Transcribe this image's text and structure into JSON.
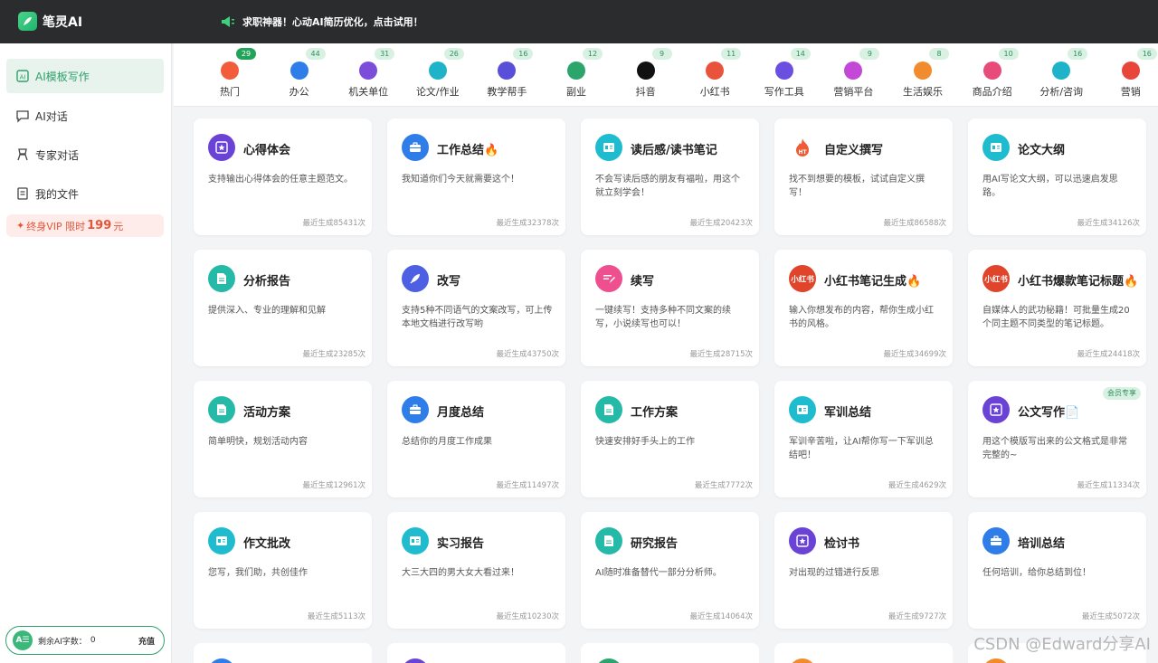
{
  "app": {
    "name": "笔灵AI",
    "promo": "求职神器！心动AI简历优化，点击试用！"
  },
  "sidebar": {
    "items": [
      {
        "label": "AI模板写作",
        "icon": "template-writing-icon",
        "active": true
      },
      {
        "label": "AI对话",
        "icon": "chat-icon",
        "active": false
      },
      {
        "label": "专家对话",
        "icon": "expert-icon",
        "active": false
      },
      {
        "label": "我的文件",
        "icon": "file-icon",
        "active": false
      }
    ],
    "vip": {
      "text": "终身VIP 限时",
      "price": "199",
      "unit": "元"
    },
    "quota": {
      "badge": "A☰",
      "label": "剩余AI字数：",
      "count": "0",
      "button": "充值"
    }
  },
  "categories": [
    {
      "label": "热门",
      "count": "29",
      "color": "#f25c3b",
      "icon": "hot-icon",
      "dark": true
    },
    {
      "label": "办公",
      "count": "44",
      "color": "#2f7de8",
      "icon": "briefcase-icon"
    },
    {
      "label": "机关单位",
      "count": "31",
      "color": "#7c4ddb",
      "icon": "building-icon"
    },
    {
      "label": "论文/作业",
      "count": "26",
      "color": "#1fb3c9",
      "icon": "paper-icon"
    },
    {
      "label": "教学帮手",
      "count": "16",
      "color": "#5a4fd9",
      "icon": "graduation-cap-icon"
    },
    {
      "label": "副业",
      "count": "12",
      "color": "#2ba56b",
      "icon": "side-job-icon"
    },
    {
      "label": "抖音",
      "count": "9",
      "color": "#111111",
      "icon": "douyin-icon"
    },
    {
      "label": "小红书",
      "count": "11",
      "color": "#e9533b",
      "icon": "xiaohongshu-icon"
    },
    {
      "label": "写作工具",
      "count": "14",
      "color": "#6a4fe0",
      "icon": "writing-tool-icon"
    },
    {
      "label": "营销平台",
      "count": "9",
      "color": "#c448d8",
      "icon": "tag-icon"
    },
    {
      "label": "生活娱乐",
      "count": "8",
      "color": "#f28b2e",
      "icon": "microphone-icon"
    },
    {
      "label": "商品介绍",
      "count": "10",
      "color": "#e84a7a",
      "icon": "product-icon"
    },
    {
      "label": "分析/咨询",
      "count": "16",
      "color": "#1fb3c9",
      "icon": "analysis-icon"
    },
    {
      "label": "营销",
      "count": "16",
      "color": "#e8453b",
      "icon": "marketing-icon"
    }
  ],
  "cards": [
    {
      "title": "心得体会",
      "desc": "支持输出心得体会的任意主题范文。",
      "count": "最近生成85431次",
      "color": "#6a43d6",
      "icon": "star-icon"
    },
    {
      "title": "工作总结🔥",
      "desc": "我知道你们今天就需要这个！",
      "count": "最近生成32378次",
      "color": "#2f7de8",
      "icon": "briefcase-icon"
    },
    {
      "title": "读后感/读书笔记",
      "desc": "不会写读后感的朋友有福啦，用这个就立刻学会！",
      "count": "最近生成20423次",
      "color": "#1fbccf",
      "icon": "book-icon"
    },
    {
      "title": "自定义撰写",
      "desc": "找不到想要的模板，试试自定义撰写！",
      "count": "最近生成86588次",
      "color": "#f05a35",
      "icon": "hot-icon",
      "hot": true
    },
    {
      "title": "论文大纲",
      "desc": "用AI写论文大纲，可以迅速启发思路。",
      "count": "最近生成34126次",
      "color": "#1fbccf",
      "icon": "book-icon"
    },
    {
      "title": "分析报告",
      "desc": "提供深入、专业的理解和见解",
      "count": "最近生成23285次",
      "color": "#25b9a8",
      "icon": "document-icon"
    },
    {
      "title": "改写",
      "desc": "支持5种不同语气的文案改写，可上传本地文档进行改写哟",
      "count": "最近生成43750次",
      "color": "#4d5fe3",
      "icon": "rocket-icon"
    },
    {
      "title": "续写",
      "desc": "一键续写！支持多种不同文案的续写，小说续写也可以！",
      "count": "最近生成28715次",
      "color": "#ee4f8e",
      "icon": "edit-icon"
    },
    {
      "title": "小红书笔记生成🔥",
      "desc": "输入你想发布的内容，帮你生成小红书的风格。",
      "count": "最近生成34699次",
      "color": "#e0442a",
      "icon": "xiaohongshu-icon",
      "xhs": true
    },
    {
      "title": "小红书爆款笔记标题🔥",
      "desc": "自媒体人的武功秘籍！可批量生成20个同主题不同类型的笔记标题。",
      "count": "最近生成24418次",
      "color": "#e0442a",
      "icon": "xiaohongshu-icon",
      "xhs": true
    },
    {
      "title": "活动方案",
      "desc": "简单明快，规划活动内容",
      "count": "最近生成12961次",
      "color": "#25b9a8",
      "icon": "document-icon"
    },
    {
      "title": "月度总结",
      "desc": "总结你的月度工作成果",
      "count": "最近生成11497次",
      "color": "#2f7de8",
      "icon": "briefcase-icon"
    },
    {
      "title": "工作方案",
      "desc": "快速安排好手头上的工作",
      "count": "最近生成7772次",
      "color": "#25b9a8",
      "icon": "document-icon"
    },
    {
      "title": "军训总结",
      "desc": "军训辛苦啦，让AI帮你写一下军训总结吧！",
      "count": "最近生成4629次",
      "color": "#1fbccf",
      "icon": "book-icon"
    },
    {
      "title": "公文写作📄",
      "desc": "用这个模版写出来的公文格式是非常完整的~",
      "count": "最近生成11334次",
      "color": "#6a43d6",
      "icon": "star-icon",
      "member": "会员专享"
    },
    {
      "title": "作文批改",
      "desc": "您写，我们助，共创佳作",
      "count": "最近生成5113次",
      "color": "#1fbccf",
      "icon": "book-icon"
    },
    {
      "title": "实习报告",
      "desc": "大三大四的男大女大看过来！",
      "count": "最近生成10230次",
      "color": "#1fbccf",
      "icon": "book-icon"
    },
    {
      "title": "研究报告",
      "desc": "AI随时准备替代一部分分析师。",
      "count": "最近生成14064次",
      "color": "#25b9a8",
      "icon": "document-icon"
    },
    {
      "title": "检讨书",
      "desc": "对出现的过错进行反思",
      "count": "最近生成9727次",
      "color": "#6a43d6",
      "icon": "star-icon"
    },
    {
      "title": "培训总结",
      "desc": "任何培训，给你总结到位！",
      "count": "最近生成5072次",
      "color": "#2f7de8",
      "icon": "briefcase-icon"
    }
  ],
  "partial_cards": [
    "#2f7de8",
    "#6a43d6",
    "#2ba56b",
    "#f28b2e",
    "#f28b2e"
  ],
  "watermark": "CSDN @Edward分享AI"
}
